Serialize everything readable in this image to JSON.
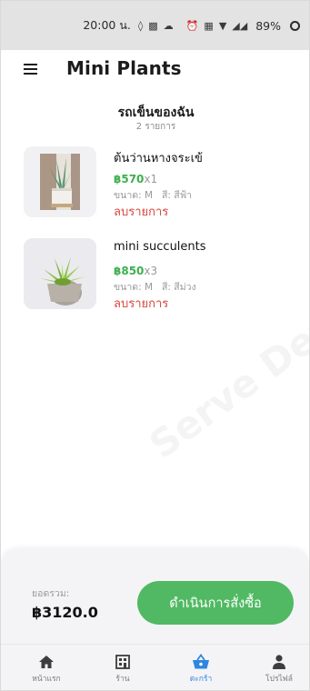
{
  "status_bar": {
    "time": "20:00 น.",
    "battery": "89%",
    "icons": [
      "location-icon",
      "gallery-icon",
      "cloud-icon",
      "alarm-icon",
      "vibrate-icon",
      "wifi-icon",
      "signal-icon"
    ]
  },
  "app_bar": {
    "title": "Mini Plants",
    "menu_icon": "hamburger-icon"
  },
  "cart": {
    "title": "รถเข็นของฉัน",
    "count_text": "2 รายการ",
    "items": [
      {
        "name": "ต้นว่านหางจระเข้",
        "price": "฿570",
        "qty": "x1",
        "meta": "ขนาด: M   สี: สีฟ้า",
        "remove_label": "ลบรายการ"
      },
      {
        "name": "mini succulents",
        "price": "฿850",
        "qty": "x3",
        "meta": "ขนาด: M   สี: สีม่วง",
        "remove_label": "ลบรายการ"
      }
    ]
  },
  "checkout": {
    "total_label": "ยอดรวม:",
    "total_value": "฿3120.0",
    "button_label": "ดำเนินการสั่งซื้อ"
  },
  "bottom_nav": {
    "items": [
      {
        "label": "หน้าแรก",
        "icon": "home-icon"
      },
      {
        "label": "ร้าน",
        "icon": "store-icon"
      },
      {
        "label": "ตะกร้า",
        "icon": "basket-icon"
      },
      {
        "label": "โปรไฟล์",
        "icon": "person-icon"
      }
    ],
    "active_index": 2
  },
  "colors": {
    "accent_green": "#51b963",
    "price_green": "#3fae4f",
    "remove_red": "#d9473f",
    "active_blue": "#2f86e0"
  }
}
